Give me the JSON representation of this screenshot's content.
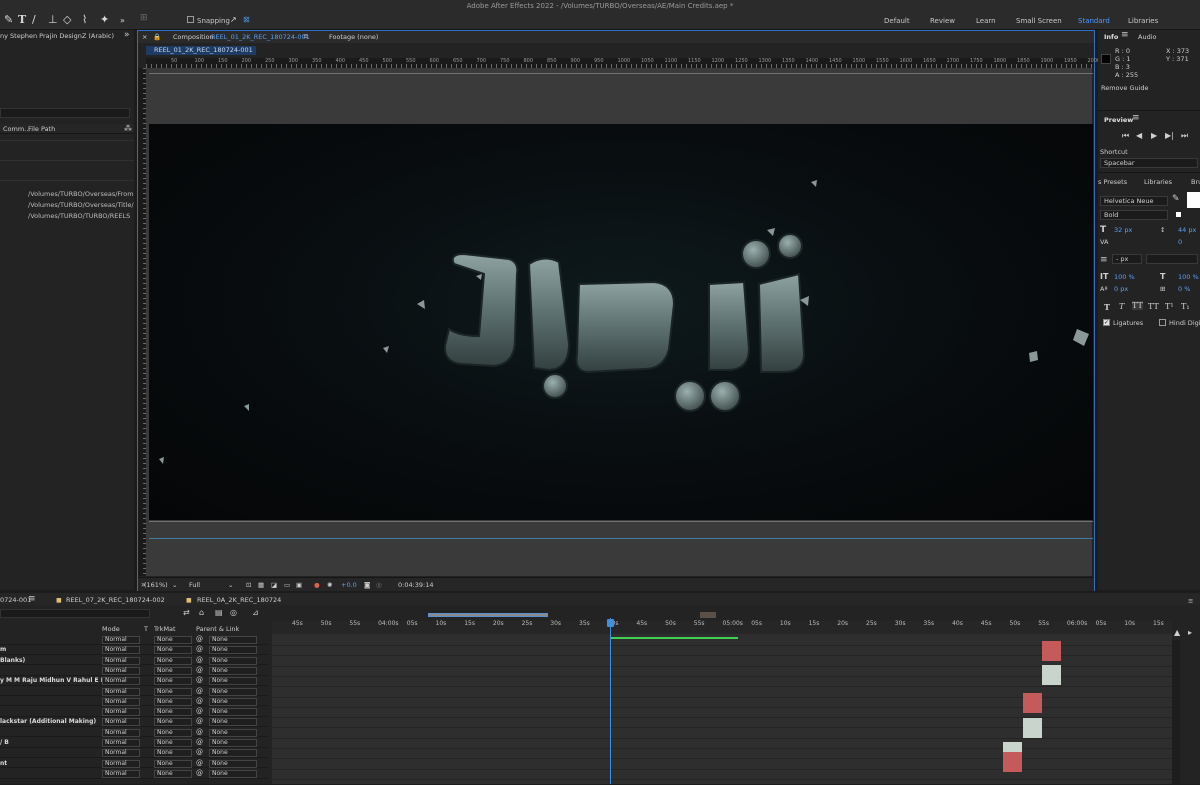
{
  "app": {
    "title": "Adobe After Effects 2022 - /Volumes/TURBO/Overseas/AE/Main Credits.aep *"
  },
  "toolbar": {
    "snapping_label": "Snapping",
    "workspaces": [
      "Default",
      "Review",
      "Learn",
      "Small Screen",
      "Standard",
      "Libraries"
    ],
    "active_workspace": "Standard"
  },
  "project_panel": {
    "title": "ny Stephen Prajin DesignZ (Arabic)",
    "col_comment": "Comm...",
    "col_filepath": "File Path",
    "paths": [
      "/Volumes/TURBO/Overseas/From",
      "/Volumes/TURBO/Overseas/Title/",
      "/Volumes/TURBO/TURBO/REELS"
    ]
  },
  "composition": {
    "tab_prefix": "Composition",
    "tab_name": "REEL_01_2K_REC_180724-001",
    "footage_tab": "Footage (none)",
    "breadcrumb": "REEL_01_2K_REC_180724-001",
    "title_art": "تيربو",
    "zoom": "(161%)",
    "resolution": "Full",
    "exposure": "+0.0",
    "timecode": "0:04:39:14",
    "ruler_labels": [
      "50",
      "100",
      "150",
      "200",
      "250",
      "300",
      "350",
      "400",
      "450",
      "500",
      "550",
      "600",
      "650",
      "700",
      "750",
      "800",
      "850",
      "900",
      "950",
      "1000",
      "1050",
      "1100",
      "1150",
      "1200",
      "1250",
      "1300",
      "1350",
      "1400",
      "1450",
      "1500",
      "1550",
      "1600",
      "1650",
      "1700",
      "1750",
      "1800",
      "1850",
      "1900",
      "1950",
      "2000"
    ]
  },
  "info_panel": {
    "tab_info": "Info",
    "tab_audio": "Audio",
    "r": "R : 0",
    "g": "G : 1",
    "b": "B : 3",
    "a": "A : 255",
    "x": "X : 373",
    "y": "Y : 371",
    "remove_guide": "Remove Guide"
  },
  "preview_panel": {
    "title": "Preview",
    "shortcut_label": "Shortcut",
    "shortcut_value": "Spacebar"
  },
  "character_panel": {
    "tab_presets": "s Presets",
    "tab_libraries": "Libraries",
    "tab_brushes": "Bru",
    "font": "Helvetica Neue",
    "style": "Bold",
    "size": "32 px",
    "leading": "44 px",
    "kerning": "0",
    "stroke": "- px",
    "vscale": "100 %",
    "hscale": "100 %",
    "baseline": "0 px",
    "tsume": "0 %",
    "ligatures": "Ligatures",
    "hindi_digits": "Hindi Digits"
  },
  "timeline": {
    "tabs": [
      "0724-001",
      "REEL_07_2K_REC_180724-002",
      "REEL_0A_2K_REC_180724"
    ],
    "col_mode": "Mode",
    "col_t": "T",
    "col_trkmat": "TrkMat",
    "col_parent": "Parent & Link",
    "ticks": [
      "45s",
      "50s",
      "55s",
      "04:00s",
      "05s",
      "10s",
      "15s",
      "20s",
      "25s",
      "30s",
      "35s",
      "40s",
      "45s",
      "50s",
      "55s",
      "05:00s",
      "05s",
      "10s",
      "15s",
      "20s",
      "25s",
      "30s",
      "35s",
      "40s",
      "45s",
      "50s",
      "55s",
      "06:00s",
      "05s",
      "10s",
      "15s"
    ],
    "rows": [
      {
        "name": "",
        "mode": "Normal",
        "trkmat": "None",
        "parent": "None"
      },
      {
        "name": "m",
        "mode": "Normal",
        "trkmat": "None",
        "parent": "None"
      },
      {
        "name": "Blanks)",
        "mode": "Normal",
        "trkmat": "None",
        "parent": "None"
      },
      {
        "name": "",
        "mode": "Normal",
        "trkmat": "None",
        "parent": "None"
      },
      {
        "name": "y M M Raju Midhun V Rahul E R",
        "mode": "Normal",
        "trkmat": "None",
        "parent": "None"
      },
      {
        "name": "",
        "mode": "Normal",
        "trkmat": "None",
        "parent": "None"
      },
      {
        "name": "",
        "mode": "Normal",
        "trkmat": "None",
        "parent": "None"
      },
      {
        "name": "",
        "mode": "Normal",
        "trkmat": "None",
        "parent": "None"
      },
      {
        "name": "lackstar (Additional Making)",
        "mode": "Normal",
        "trkmat": "None",
        "parent": "None"
      },
      {
        "name": "",
        "mode": "Normal",
        "trkmat": "None",
        "parent": "None"
      },
      {
        "name": "/ B",
        "mode": "Normal",
        "trkmat": "None",
        "parent": "None"
      },
      {
        "name": "",
        "mode": "Normal",
        "trkmat": "None",
        "parent": "None"
      },
      {
        "name": "nt",
        "mode": "Normal",
        "trkmat": "None",
        "parent": "None"
      },
      {
        "name": "",
        "mode": "Normal",
        "trkmat": "None",
        "parent": "None"
      }
    ]
  },
  "colors": {
    "accent_blue": "#2f6fc4",
    "clip_red": "#c45a5a",
    "clip_light": "#c8d4cc",
    "work_green": "#3fd04f"
  }
}
